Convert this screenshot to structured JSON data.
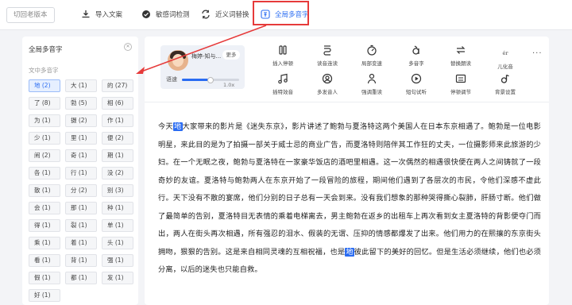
{
  "topbar": {
    "old_version": "切回老版本",
    "buttons": [
      {
        "label": "导入文案",
        "icon": "import-icon"
      },
      {
        "label": "敏感词检测",
        "icon": "sensitive-check-icon"
      },
      {
        "label": "近义词替换",
        "icon": "synonym-replace-icon"
      },
      {
        "label": "全局多音字",
        "icon": "global-polyphone-icon"
      }
    ],
    "accent": "#2a6cf2",
    "highlight_color": "#e63a3a"
  },
  "sidebar": {
    "title": "全局多音字",
    "subtitle": "文中多音字",
    "chars": [
      {
        "label": "地 (2)",
        "selected": true
      },
      {
        "label": "大 (1)"
      },
      {
        "label": "的 (27)"
      },
      {
        "label": "了 (8)"
      },
      {
        "label": "勃 (5)"
      },
      {
        "label": "相 (6)"
      },
      {
        "label": "为 (1)"
      },
      {
        "label": "摄 (2)"
      },
      {
        "label": "作 (1)"
      },
      {
        "label": "少 (1)"
      },
      {
        "label": "里 (1)"
      },
      {
        "label": "便 (2)"
      },
      {
        "label": "闹 (2)"
      },
      {
        "label": "奇 (1)"
      },
      {
        "label": "期 (1)"
      },
      {
        "label": "各 (1)"
      },
      {
        "label": "行 (1)"
      },
      {
        "label": "没 (2)"
      },
      {
        "label": "散 (1)"
      },
      {
        "label": "分 (2)"
      },
      {
        "label": "别 (3)"
      },
      {
        "label": "会 (1)"
      },
      {
        "label": "那 (1)"
      },
      {
        "label": "种 (1)"
      },
      {
        "label": "得 (1)"
      },
      {
        "label": "裂 (1)"
      },
      {
        "label": "单 (1)"
      },
      {
        "label": "乘 (1)"
      },
      {
        "label": "着 (1)"
      },
      {
        "label": "头 (1)"
      },
      {
        "label": "看 (1)"
      },
      {
        "label": "背 (1)"
      },
      {
        "label": "强 (1)"
      },
      {
        "label": "假 (1)"
      },
      {
        "label": "都 (1)"
      },
      {
        "label": "发 (1)"
      },
      {
        "label": "好 (1)"
      }
    ]
  },
  "voice": {
    "name": "梅婷-知与...",
    "more": "更多",
    "speed_label": "语速",
    "speed_value": "1.0x",
    "speed_fraction": 0.5
  },
  "tools": [
    {
      "label": "插入停顿",
      "icon": "insert-pause-icon"
    },
    {
      "label": "读音连读",
      "icon": "liaison-icon"
    },
    {
      "label": "局部变速",
      "icon": "local-speed-icon"
    },
    {
      "label": "多音字",
      "icon": "polyphone-icon"
    },
    {
      "label": "替换朗读",
      "icon": "replace-reading-icon"
    },
    {
      "label": "儿化音",
      "icon": "er-icon",
      "glyph": "ér"
    },
    {
      "label": "插特效音",
      "icon": "sound-effect-icon"
    },
    {
      "label": "多发音人",
      "icon": "multi-speaker-icon"
    },
    {
      "label": "强调重读",
      "icon": "emphasis-icon"
    },
    {
      "label": "短句试听",
      "icon": "preview-icon"
    },
    {
      "label": "停顿调节",
      "icon": "pause-adjust-icon"
    },
    {
      "label": "背景设置",
      "icon": "bgm-icon"
    }
  ],
  "tools_more": "···",
  "article": {
    "segments": [
      "今天",
      "大家带来的影片是《迷失东京》，影片讲述了鲍勃与夏洛特这两个美国人在日本东京相遇了。鲍勃是一位电影明星，来此目的是为了拍摄一部关于威士忌的商业广告，而夏洛特则陪伴其工作狂的丈夫，一位摄影师来此旅游的少妇。在一个无眠之夜，鲍勃与夏洛特在一家豪华饭店的酒吧里相遇。这一次偶然的相遇很快便在两人之间铸就了一段奇妙的友谊。夏洛特与鲍勃两人在东京开始了一段冒险的旅程，期间他们遇到了各层次的市民，令他们深感不虚此行。天下没有不散的宴席，他们分别的日子总有一天会到来。没有我们想象的那种哭得撕心裂肺，肝肠寸断。他们做了最简单的告别，夏洛特目无表情的乘着电梯离去，男主鲍勃在返乡的出租车上再次看到女主夏洛特的背影便夺门而出，两人在街头再次相遇，所有强忍的泪水、假装的无谓、压抑的情感都爆发了出来。他们用力的在熙攘的东京街头拥吻，狠狠的告别。这是来自相同灵魂的互相祝福，也是",
      "彼此留下的美好的回忆。但是生活必须继续，他们也必须分离，以后的迷失也只能自救。"
    ],
    "highlight_char": "地"
  }
}
